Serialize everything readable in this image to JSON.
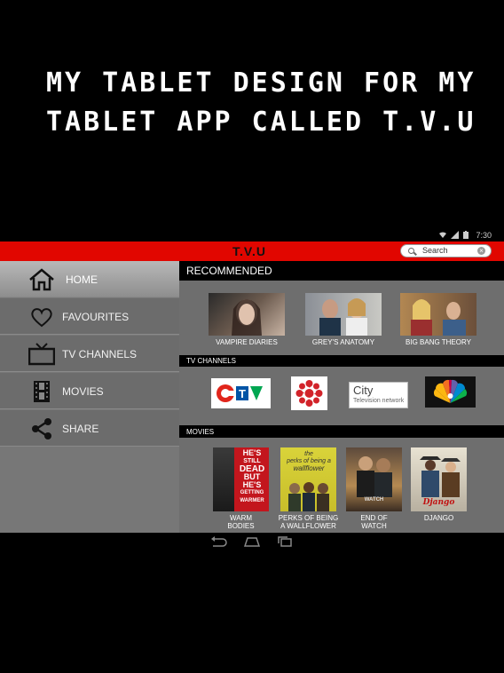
{
  "headline": {
    "line1": "MY TABLET DESIGN FOR MY",
    "line2": "TABLET APP CALLED T.V.U"
  },
  "status_bar": {
    "time": "7:30",
    "icons": [
      "wifi-icon",
      "signal-icon",
      "battery-icon"
    ]
  },
  "app_bar": {
    "title": "T.V.U",
    "search_placeholder": "Search"
  },
  "sidebar": {
    "items": [
      {
        "label": "HOME",
        "icon": "home-icon",
        "active": true
      },
      {
        "label": "FAVOURITES",
        "icon": "heart-icon",
        "active": false
      },
      {
        "label": "TV CHANNELS",
        "icon": "tv-icon",
        "active": false
      },
      {
        "label": "MOVIES",
        "icon": "film-icon",
        "active": false
      },
      {
        "label": "SHARE",
        "icon": "share-icon",
        "active": false
      }
    ]
  },
  "recommended": {
    "heading": "RECOMMENDED",
    "items": [
      {
        "title": "VAMPIRE DIARIES"
      },
      {
        "title": "GREY'S ANATOMY"
      },
      {
        "title": "BIG BANG THEORY"
      }
    ]
  },
  "tv_channels": {
    "heading": "TV CHANNELS",
    "items": [
      {
        "name": "CTV",
        "icon": "ctv-logo"
      },
      {
        "name": "CBC",
        "icon": "cbc-logo"
      },
      {
        "name": "City",
        "sub": "Television network",
        "icon": "city-logo"
      },
      {
        "name": "NBC",
        "icon": "nbc-peacock-logo"
      }
    ]
  },
  "movies": {
    "heading": "MOVIES",
    "items": [
      {
        "caption_line1": "WARM",
        "caption_line2": "BODIES",
        "poster_text": [
          "HE'S",
          "STILL",
          "DEAD",
          "BUT",
          "HE'S",
          "GETTING",
          "WARMER"
        ]
      },
      {
        "caption_line1": "PERKS OF BEING",
        "caption_line2": "A WALLFLOWER",
        "poster_text": [
          "the",
          "perks of being a",
          "wallflower"
        ]
      },
      {
        "caption_line1": "END OF",
        "caption_line2": "WATCH",
        "poster_text": [
          "WATCH"
        ]
      },
      {
        "caption_line1": "DJANGO",
        "caption_line2": "",
        "poster_text": [
          "Django"
        ]
      }
    ]
  },
  "nav_bar": {
    "buttons": [
      "back-icon",
      "home-nav-icon",
      "recents-icon"
    ]
  },
  "colors": {
    "accent": "#e10600",
    "sidebar": "#6c6c6c",
    "content": "#6e6e6e",
    "background": "#000000"
  }
}
